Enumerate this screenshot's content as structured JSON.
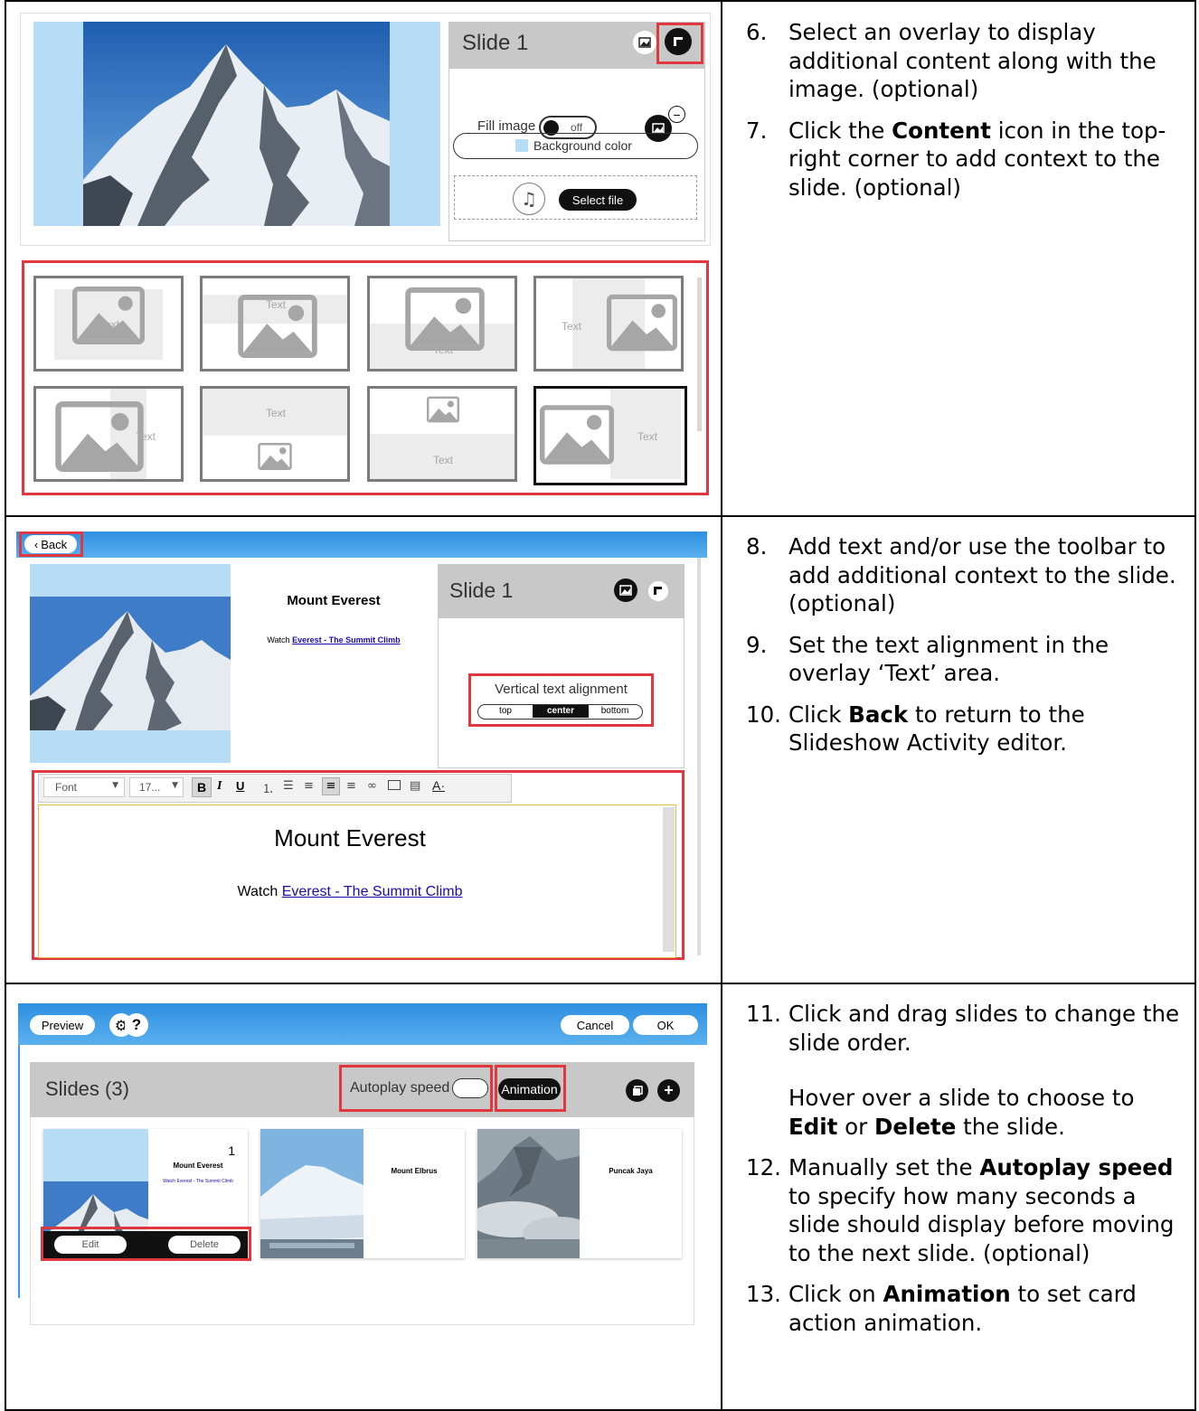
{
  "steps_1": [
    {
      "num": "6.",
      "parts": [
        "Select an overlay to display additional content along with the image. (optional)"
      ]
    },
    {
      "num": "7.",
      "parts": [
        "Click the ",
        {
          "b": "Content"
        },
        " icon in the top-right corner to add context to the slide. (optional)"
      ]
    }
  ],
  "steps_2": [
    {
      "num": "8.",
      "parts": [
        "Add text and/or use the toolbar to add additional context to the slide. (optional)"
      ]
    },
    {
      "num": "9.",
      "parts": [
        "Set the text alignment in the overlay ‘Text’ area."
      ]
    },
    {
      "num": "10.",
      "parts": [
        "Click ",
        {
          "b": "Back"
        },
        " to return to the Slideshow Activity editor."
      ]
    }
  ],
  "steps_3": [
    {
      "num": "11.",
      "parts": [
        "Click and drag slides to change the slide order."
      ],
      "para": [
        "Hover over a slide to choose to ",
        {
          "b": "Edit"
        },
        " or ",
        {
          "b": "Delete"
        },
        " the slide."
      ]
    },
    {
      "num": "12.",
      "parts": [
        "Manually set the ",
        {
          "b": "Autoplay speed"
        },
        " to specify how many seconds a slide should display before moving to the next slide. (optional)"
      ]
    },
    {
      "num": "13.",
      "parts": [
        "Click on ",
        {
          "b": "Animation"
        },
        " to set card action animation."
      ]
    }
  ],
  "panel1": {
    "slide_title": "Slide 1",
    "fill_image_label": "Fill image",
    "fill_image_state": "off",
    "background_color_label": "Background color",
    "select_file_label": "Select file",
    "layouts": [
      {
        "text": "Text"
      },
      {
        "text": "Text"
      },
      {
        "text": "Text"
      },
      {
        "text": "Text"
      },
      {
        "text": "Text"
      },
      {
        "text": "Text"
      },
      {
        "text": "Text"
      },
      {
        "text": "Text"
      }
    ]
  },
  "panel2": {
    "back_label": "Back",
    "slide_title": "Slide 1",
    "preview_heading": "Mount Everest",
    "preview_watch": "Watch ",
    "preview_link": "Everest - The Summit Climb",
    "vertical_alignment_label": "Vertical text alignment",
    "alignment_options": [
      "top",
      "center",
      "bottom"
    ],
    "alignment_selected": "center",
    "toolbar": {
      "font": "Font",
      "size": "17...",
      "bold": "B",
      "italic": "I",
      "underline": "U"
    },
    "editor_heading": "Mount Everest",
    "editor_watch": "Watch ",
    "editor_link": "Everest - The Summit Climb"
  },
  "panel3": {
    "preview_label": "Preview",
    "help_label": "?",
    "cancel_label": "Cancel",
    "ok_label": "OK",
    "slides_title": "Slides (3)",
    "autoplay_label": "Autoplay speed",
    "animation_label": "Animation",
    "slides": [
      {
        "index": "1",
        "title": "Mount Everest",
        "subtitle": "Watch Everest - The Summit Climb",
        "edit_label": "Edit",
        "delete_label": "Delete"
      },
      {
        "title": "Mount Elbrus"
      },
      {
        "title": "Puncak Jaya"
      }
    ]
  },
  "colors": {
    "accent_red": "#e0383e",
    "sky": "#b7dcf5",
    "header_gray": "#c8c8c8",
    "toolbar_blue": "#3d9ae8"
  }
}
